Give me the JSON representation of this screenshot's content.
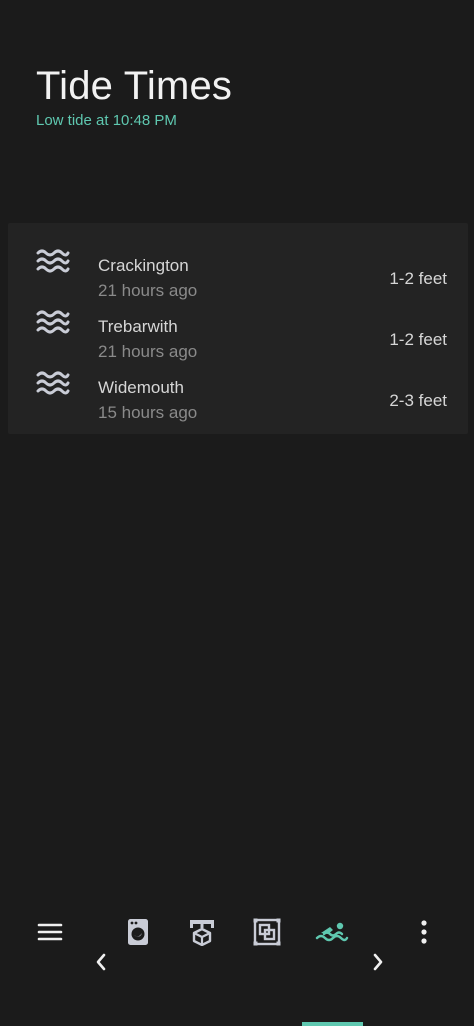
{
  "header": {
    "title": "Tide Times",
    "subtitle": "Low tide at 10:48 PM"
  },
  "tides": [
    {
      "name": "Crackington",
      "updated": "21 hours ago",
      "height": "1-2 feet",
      "icon": "waves-icon"
    },
    {
      "name": "Trebarwith",
      "updated": "21 hours ago",
      "height": "1-2 feet",
      "icon": "waves-icon"
    },
    {
      "name": "Widemouth",
      "updated": "15 hours ago",
      "height": "2-3 feet",
      "icon": "waves-icon"
    }
  ],
  "nav": {
    "icons": [
      "menu-icon",
      "washing-machine-icon",
      "printer-3d-icon",
      "layers-icon",
      "swimmer-icon",
      "more-vert-icon",
      "chevron-left-icon",
      "chevron-right-icon"
    ],
    "active": "swimmer-icon"
  },
  "colors": {
    "background": "#1b1b1b",
    "card": "#232323",
    "accent": "#5fc8b0",
    "icon": "#c9ccd6"
  }
}
